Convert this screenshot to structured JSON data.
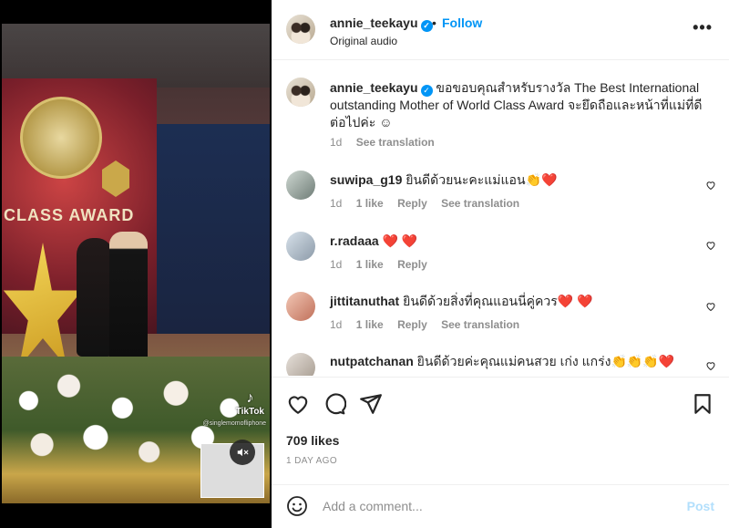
{
  "media": {
    "tiktok_label": "TikTok",
    "tiktok_handle": "@singlemomofliphone",
    "stage_text": "CLASS AWARD",
    "mute_icon": "speaker-muted-icon"
  },
  "header": {
    "username": "annie_teekayu",
    "separator": "•",
    "follow_label": "Follow",
    "subtitle": "Original audio",
    "more_label": "•••"
  },
  "caption": {
    "username": "annie_teekayu",
    "text": "ขอขอบคุณสำหรับรางวัล The Best International outstanding Mother of World Class Award จะยึดถือและหน้าที่แม่ที่ดีต่อไปค่ะ ☺",
    "time": "1d",
    "translate": "See translation"
  },
  "comments": [
    {
      "username": "suwipa_g19",
      "text": "ยินดีด้วยนะคะแม่แอน👏❤️",
      "time": "1d",
      "likes": "1 like",
      "reply": "Reply",
      "translate": "See translation"
    },
    {
      "username": "r.radaaa",
      "text": "❤️ ❤️",
      "time": "1d",
      "likes": "1 like",
      "reply": "Reply",
      "translate": ""
    },
    {
      "username": "jittitanuthat",
      "text": "ยินดีด้วยสิ่งที่คุณแอนนี่คู่ควร❤️ ❤️",
      "time": "1d",
      "likes": "1 like",
      "reply": "Reply",
      "translate": "See translation"
    },
    {
      "username": "nutpatchanan",
      "text": "ยินดีด้วยค่ะคุณแม่คนสวย เก่ง แกร่ง👏👏👏❤️",
      "time": "",
      "likes": "",
      "reply": "",
      "translate": ""
    }
  ],
  "actions": {
    "likes": "709 likes",
    "time_ago": "1 DAY AGO"
  },
  "add_comment": {
    "placeholder": "Add a comment...",
    "post_label": "Post"
  },
  "colors": {
    "accent": "#0095f6",
    "post_disabled": "#b2dffc",
    "text": "#262626",
    "muted": "#8e8e8e"
  }
}
